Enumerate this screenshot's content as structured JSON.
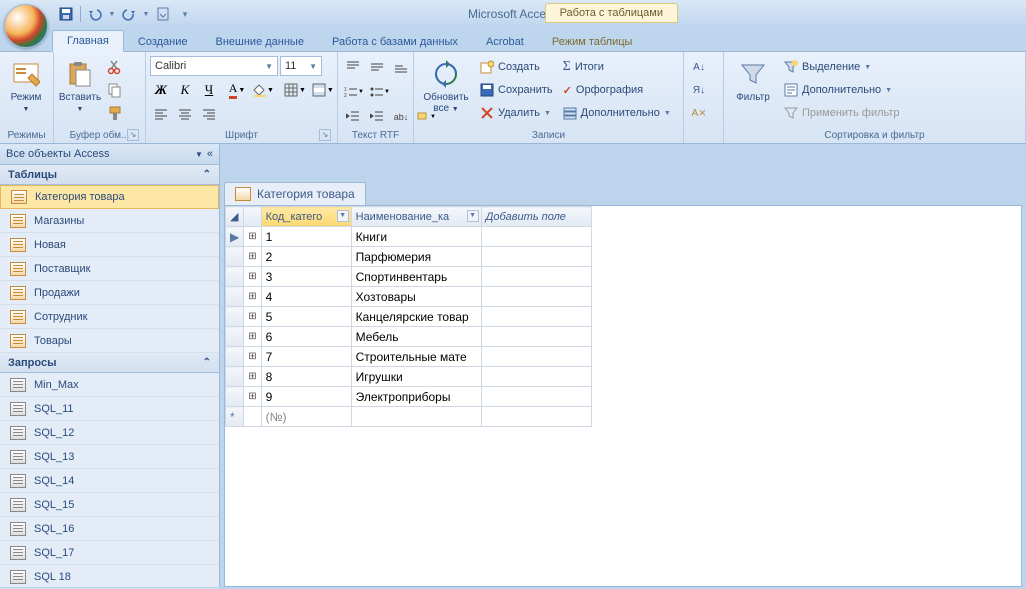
{
  "app_title": "Microsoft Access",
  "context_tool": {
    "title": "Работа с таблицами",
    "tab": "Режим таблицы"
  },
  "tabs": [
    "Главная",
    "Создание",
    "Внешние данные",
    "Работа с базами данных",
    "Acrobat"
  ],
  "active_tab": "Главная",
  "ribbon": {
    "groups": {
      "views": {
        "label": "Режимы",
        "btn": "Режим"
      },
      "clipboard": {
        "label": "Буфер обм...",
        "paste": "Вставить"
      },
      "font": {
        "label": "Шрифт",
        "name": "Calibri",
        "size": "11"
      },
      "richtext": {
        "label": "Текст RTF"
      },
      "records": {
        "label": "Записи",
        "refresh": "Обновить\nвсе",
        "new": "Создать",
        "save": "Сохранить",
        "delete": "Удалить",
        "totals": "Итоги",
        "spelling": "Орфография",
        "more": "Дополнительно"
      },
      "sortfilter": {
        "label": "Сортировка и фильтр",
        "filter": "Фильтр",
        "selection": "Выделение",
        "advanced": "Дополнительно",
        "toggle": "Применить фильтр"
      }
    }
  },
  "nav": {
    "header": "Все объекты Access",
    "sections": [
      {
        "name": "Таблицы",
        "type": "table",
        "items": [
          "Категория товара",
          "Магазины",
          "Новая",
          "Поставщик",
          "Продажи",
          "Сотрудник",
          "Товары"
        ]
      },
      {
        "name": "Запросы",
        "type": "query",
        "items": [
          "Min_Max",
          "SQL_11",
          "SQL_12",
          "SQL_13",
          "SQL_14",
          "SQL_15",
          "SQL_16",
          "SQL_17",
          "SQL 18"
        ]
      }
    ],
    "selected": "Категория товара"
  },
  "document": {
    "title": "Категория товара",
    "columns": [
      "Код_катего",
      "Наименование_ка"
    ],
    "add_field": "Добавить поле",
    "new_placeholder": "(№)",
    "rows": [
      {
        "id": 1,
        "name": "Книги"
      },
      {
        "id": 2,
        "name": "Парфюмерия"
      },
      {
        "id": 3,
        "name": "Спортинвентарь"
      },
      {
        "id": 4,
        "name": "Хозтовары"
      },
      {
        "id": 5,
        "name": "Канцелярские товар"
      },
      {
        "id": 6,
        "name": "Мебель"
      },
      {
        "id": 7,
        "name": "Строительные мате"
      },
      {
        "id": 8,
        "name": "Игрушки"
      },
      {
        "id": 9,
        "name": "Электроприборы"
      }
    ]
  }
}
